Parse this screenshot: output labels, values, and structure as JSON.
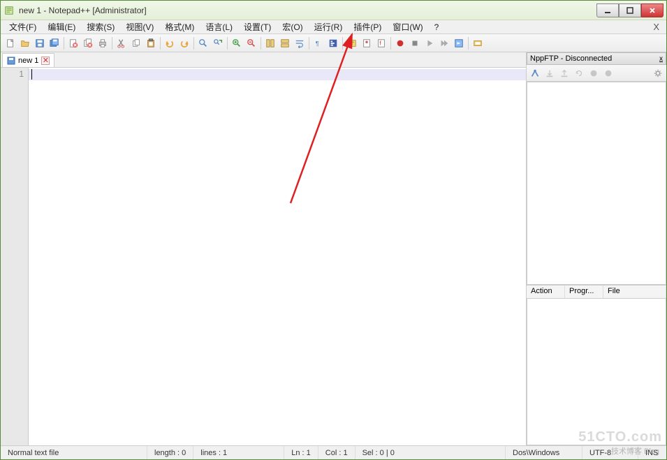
{
  "window": {
    "title": "new 1 - Notepad++ [Administrator]"
  },
  "menu": {
    "items": [
      "文件(F)",
      "编辑(E)",
      "搜索(S)",
      "视图(V)",
      "格式(M)",
      "语言(L)",
      "设置(T)",
      "宏(O)",
      "运行(R)",
      "插件(P)",
      "窗口(W)",
      "?"
    ]
  },
  "tab": {
    "name": "new 1"
  },
  "gutter": {
    "line1": "1"
  },
  "ftp": {
    "title": "NppFTP - Disconnected",
    "close_glyph": "x",
    "columns": [
      "Action",
      "Progr...",
      "File"
    ]
  },
  "status": {
    "filetype": "Normal text file",
    "length": "length : 0",
    "lines": "lines : 1",
    "ln": "Ln : 1",
    "col": "Col : 1",
    "sel": "Sel : 0 | 0",
    "eol": "Dos\\Windows",
    "encoding": "UTF-8",
    "mode": "INS"
  },
  "watermark": {
    "main": "51CTO.com",
    "sub": "技术博客 Blog"
  }
}
